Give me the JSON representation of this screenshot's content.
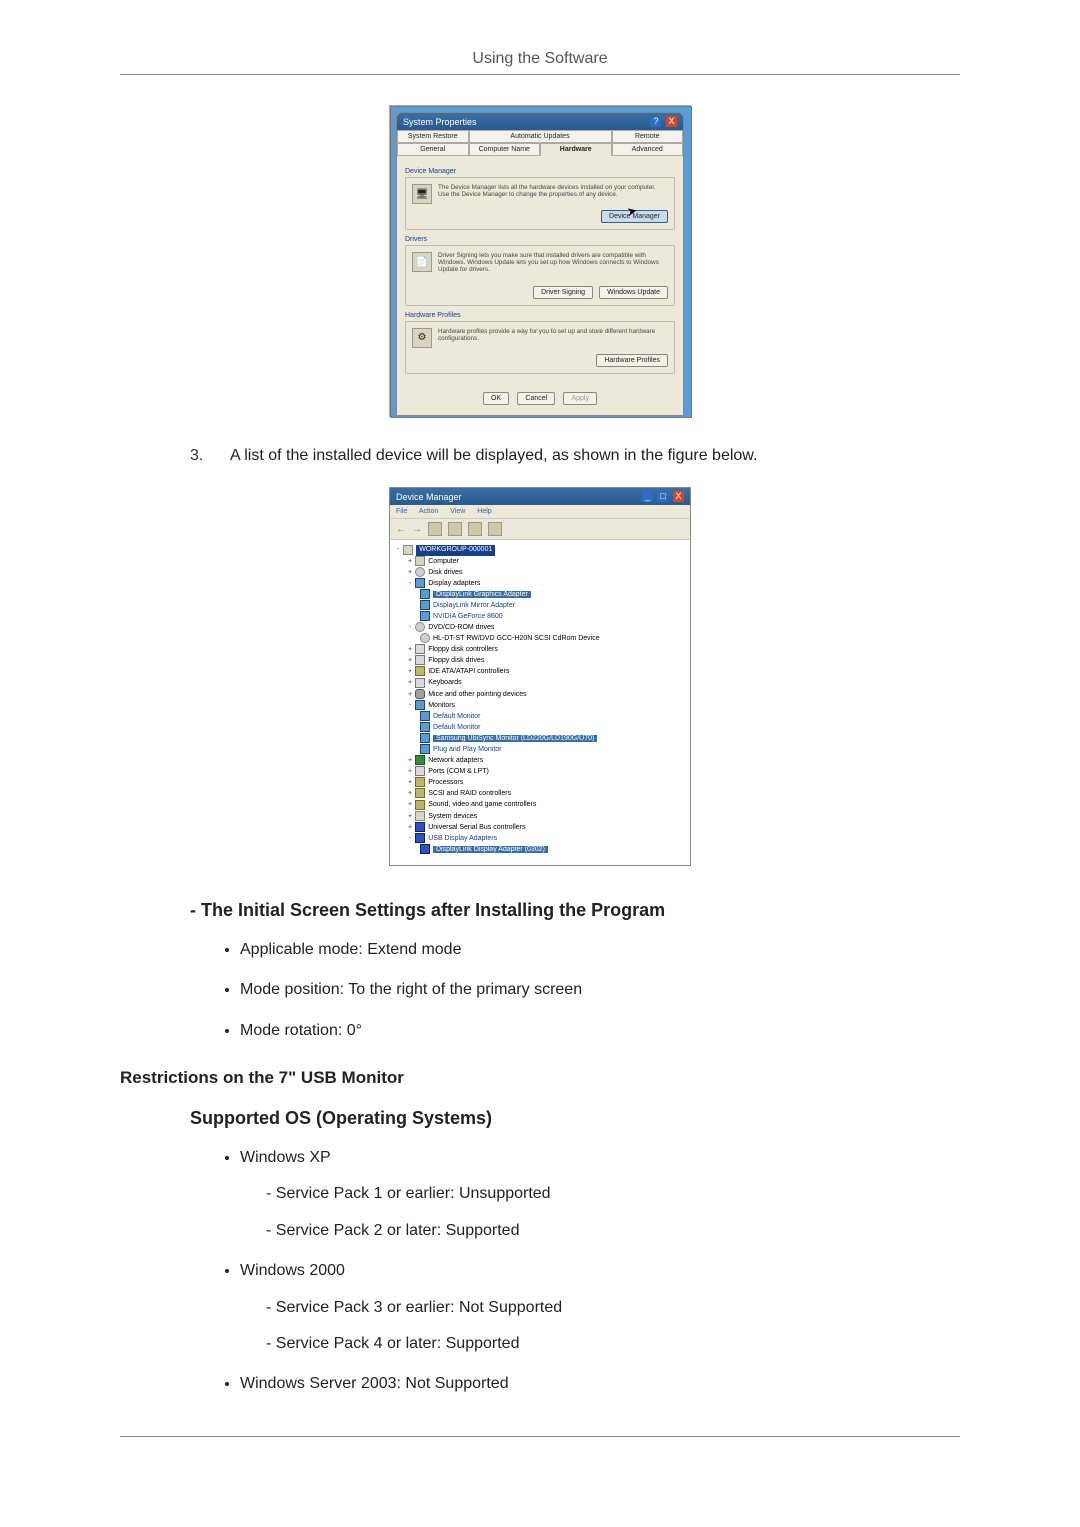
{
  "header": {
    "title": "Using the Software"
  },
  "step3": {
    "num": "3.",
    "text": "A list of the installed device will be displayed, as shown in the figure below."
  },
  "system_properties": {
    "title": "System Properties",
    "title_help": "?",
    "title_close": "X",
    "tabs": [
      "System Restore",
      "Automatic Updates",
      "Remote",
      "General",
      "Computer Name",
      "Hardware",
      "Advanced"
    ],
    "active_tab": "Hardware",
    "groups": {
      "devmgr": {
        "label": "Device Manager",
        "text": "The Device Manager lists all the hardware devices installed on your computer. Use the Device Manager to change the properties of any device.",
        "button": "Device Manager"
      },
      "drivers": {
        "label": "Drivers",
        "text": "Driver Signing lets you make sure that installed drivers are compatible with Windows. Windows Update lets you set up how Windows connects to Windows Update for drivers.",
        "btn1": "Driver Signing",
        "btn2": "Windows Update"
      },
      "hw": {
        "label": "Hardware Profiles",
        "text": "Hardware profiles provide a way for you to set up and store different hardware configurations.",
        "button": "Hardware Profiles"
      }
    },
    "footer": {
      "ok": "OK",
      "cancel": "Cancel",
      "apply": "Apply"
    }
  },
  "device_manager": {
    "title": "Device Manager",
    "menu": [
      "File",
      "Action",
      "View",
      "Help"
    ],
    "root": "WORKGROUP-000001",
    "tree": [
      {
        "pm": "+",
        "icon": "ic-comp",
        "label": "Computer"
      },
      {
        "pm": "+",
        "icon": "ic-disk",
        "label": "Disk drives"
      },
      {
        "pm": "-",
        "icon": "ic-mon",
        "label": "Display adapters",
        "children": [
          {
            "icon": "ic-mon",
            "label": "DisplayLink Graphics Adapter",
            "cls": "sel"
          },
          {
            "icon": "ic-mon",
            "label": "DisplayLink Mirror Adapter",
            "cls": "blue"
          },
          {
            "icon": "ic-mon",
            "label": "NVIDIA GeForce 8600",
            "cls": "blue"
          }
        ]
      },
      {
        "pm": "-",
        "icon": "ic-disk",
        "label": "DVD/CD-ROM drives",
        "children": [
          {
            "icon": "ic-disk",
            "label": "HL-DT-ST RW/DVD GCC-H20N SCSI CdRom Device"
          }
        ]
      },
      {
        "pm": "+",
        "icon": "ic-port",
        "label": "Floppy disk controllers"
      },
      {
        "pm": "+",
        "icon": "ic-port",
        "label": "Floppy disk drives"
      },
      {
        "pm": "+",
        "icon": "ic-chip",
        "label": "IDE ATA/ATAPI controllers"
      },
      {
        "pm": "+",
        "icon": "ic-port",
        "label": "Keyboards"
      },
      {
        "pm": "+",
        "icon": "ic-mouse",
        "label": "Mice and other pointing devices"
      },
      {
        "pm": "-",
        "icon": "ic-mon",
        "label": "Monitors",
        "children": [
          {
            "icon": "ic-mon",
            "label": "Default Monitor",
            "cls": "blue"
          },
          {
            "icon": "ic-mon",
            "label": "Default Monitor",
            "cls": "blue"
          },
          {
            "icon": "ic-mon",
            "label": "Samsung UbiSync Monitor (LD220G/LD190G/U70)",
            "cls": "sel"
          },
          {
            "icon": "ic-mon",
            "label": "Plug and Play Monitor",
            "cls": "blue"
          }
        ]
      },
      {
        "pm": "+",
        "icon": "ic-net",
        "label": "Network adapters"
      },
      {
        "pm": "+",
        "icon": "ic-port",
        "label": "Ports (COM & LPT)"
      },
      {
        "pm": "+",
        "icon": "ic-chip",
        "label": "Processors"
      },
      {
        "pm": "+",
        "icon": "ic-chip",
        "label": "SCSI and RAID controllers"
      },
      {
        "pm": "+",
        "icon": "ic-chip",
        "label": "Sound, video and game controllers"
      },
      {
        "pm": "+",
        "icon": "ic-comp",
        "label": "System devices"
      },
      {
        "pm": "+",
        "icon": "ic-usb",
        "label": "Universal Serial Bus controllers"
      },
      {
        "pm": "-",
        "icon": "ic-usb",
        "label": "USB Display Adapters",
        "cls": "blue",
        "children": [
          {
            "icon": "ic-usb",
            "label": "DisplayLink Display Adapter (0302)",
            "cls": "sel"
          }
        ]
      }
    ]
  },
  "sections": {
    "initial": {
      "title": "The Initial Screen Settings after Installing the Program",
      "items": [
        "Applicable mode: Extend mode",
        "Mode position: To the right of the primary screen",
        "Mode rotation: 0°"
      ]
    },
    "restrictions": {
      "title": "Restrictions on the 7\" USB Monitor",
      "supported_os_title": "Supported OS (Operating Systems)",
      "os": [
        {
          "name": "Windows XP",
          "sub": [
            "Service Pack 1 or earlier: Unsupported",
            "Service Pack 2 or later: Supported"
          ]
        },
        {
          "name": "Windows 2000",
          "sub": [
            "Service Pack 3 or earlier: Not Supported",
            "Service Pack 4 or later: Supported"
          ]
        },
        {
          "name": "Windows Server 2003: Not Supported",
          "sub": []
        }
      ]
    }
  }
}
